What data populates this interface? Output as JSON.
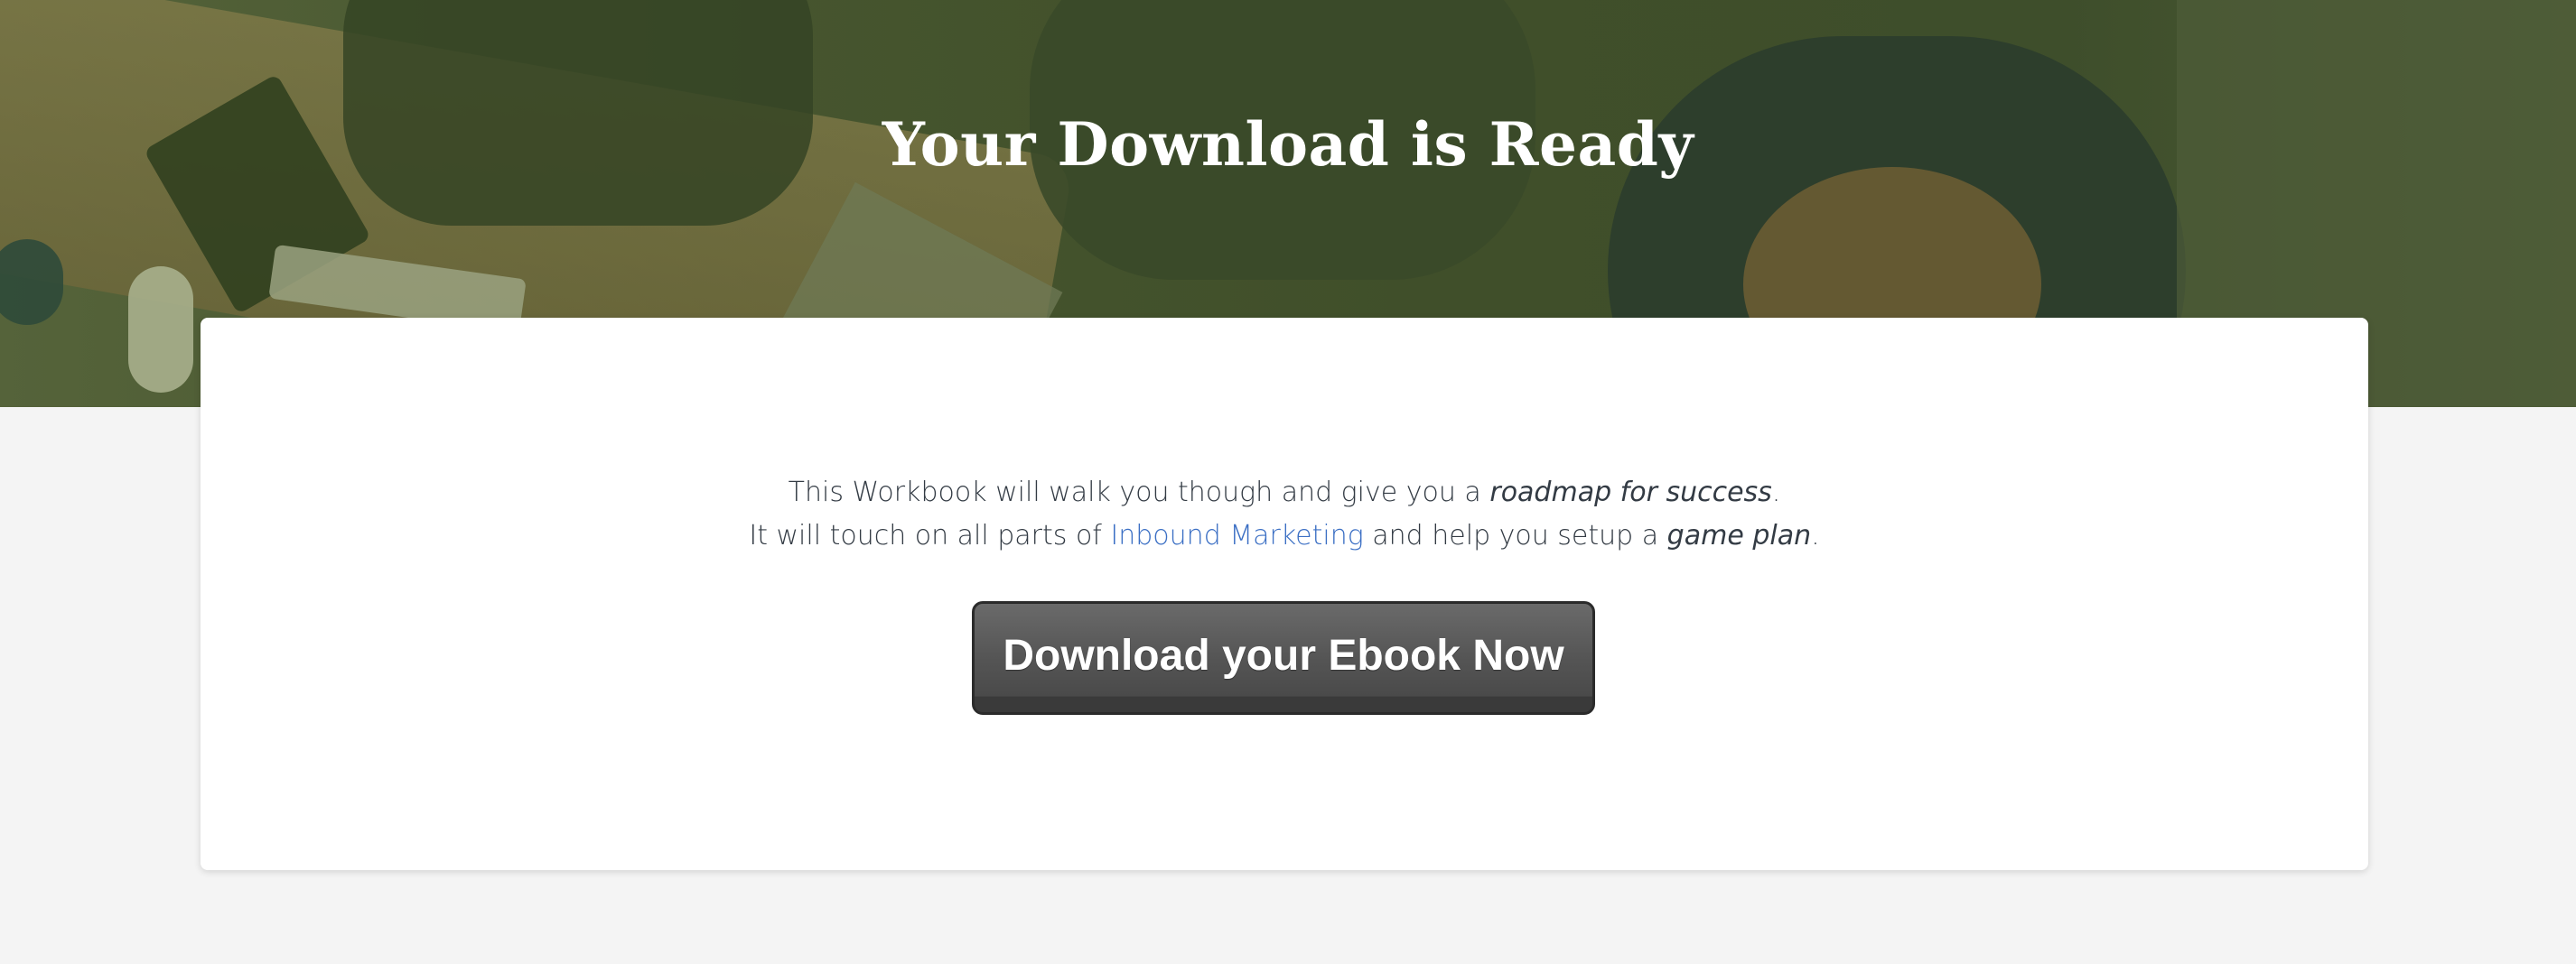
{
  "hero": {
    "title": "Your Download is Ready"
  },
  "card": {
    "line1_pre": "This Workbook will walk you though and give you a ",
    "line1_em": "roadmap for success",
    "line1_post": ".",
    "line2_pre": "It will touch on all parts of ",
    "line2_link": "Inbound Marketing",
    "line2_mid": " and help you setup a ",
    "line2_em": "game plan",
    "line2_post": ".",
    "download_button": "Download your Ebook Now"
  },
  "colors": {
    "hero_overlay": "#46552e",
    "link": "#3b6fc4",
    "button": "#555555",
    "page_background": "#f4f4f4"
  }
}
